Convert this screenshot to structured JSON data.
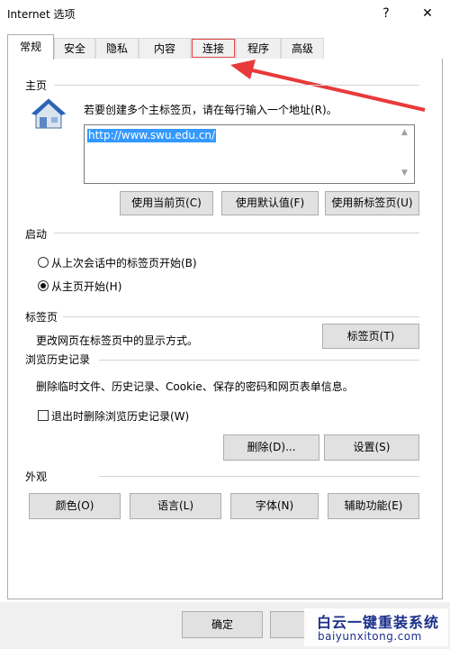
{
  "window": {
    "title": "Internet 选项",
    "help_glyph": "?",
    "close_glyph": "✕"
  },
  "tabs": [
    {
      "label": "常规",
      "active": true
    },
    {
      "label": "安全"
    },
    {
      "label": "隐私"
    },
    {
      "label": "内容"
    },
    {
      "label": "连接",
      "highlighted": true
    },
    {
      "label": "程序"
    },
    {
      "label": "高级"
    }
  ],
  "home": {
    "section": "主页",
    "description": "若要创建多个主标签页，请在每行输入一个地址(R)。",
    "url": "http://www.swu.edu.cn/",
    "btn_current": "使用当前页(C)",
    "btn_default": "使用默认值(F)",
    "btn_newtab": "使用新标签页(U)"
  },
  "startup": {
    "section": "启动",
    "option_last": "从上次会话中的标签页开始(B)",
    "option_home": "从主页开始(H)"
  },
  "tabs_section": {
    "section": "标签页",
    "description": "更改网页在标签页中的显示方式。",
    "button": "标签页(T)"
  },
  "history": {
    "section": "浏览历史记录",
    "description": "删除临时文件、历史记录、Cookie、保存的密码和网页表单信息。",
    "checkbox": "退出时删除浏览历史记录(W)",
    "btn_delete": "删除(D)...",
    "btn_settings": "设置(S)"
  },
  "appearance": {
    "section": "外观",
    "btn_colors": "颜色(O)",
    "btn_languages": "语言(L)",
    "btn_fonts": "字体(N)",
    "btn_accessibility": "辅助功能(E)"
  },
  "footer": {
    "ok": "确定"
  },
  "watermark": {
    "line1": "白云一键重装系统",
    "line2": "baiyunxitong.com"
  },
  "colors": {
    "annotation_arrow": "#e83a3a",
    "selection": "#3399ff",
    "watermark": "#1a2f8a"
  }
}
